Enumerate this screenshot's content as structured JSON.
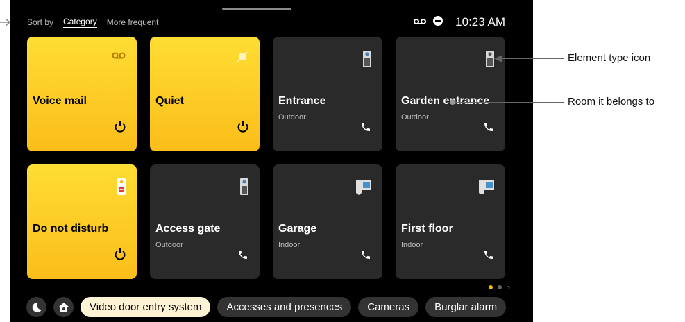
{
  "sort": {
    "label": "Sort by",
    "options": [
      "Category",
      "More frequent"
    ]
  },
  "status": {
    "time": "10:23 AM"
  },
  "tiles": [
    {
      "title": "Voice mail",
      "subtitle": ""
    },
    {
      "title": "Quiet",
      "subtitle": ""
    },
    {
      "title": "Entrance",
      "subtitle": "Outdoor"
    },
    {
      "title": "Garden entrance",
      "subtitle": "Outdoor"
    },
    {
      "title": "Do not disturb",
      "subtitle": ""
    },
    {
      "title": "Access gate",
      "subtitle": "Outdoor"
    },
    {
      "title": "Garage",
      "subtitle": "Indoor"
    },
    {
      "title": "First floor",
      "subtitle": "Indoor"
    }
  ],
  "pagination": {
    "pages": 3,
    "current": 1
  },
  "categories": [
    "Video door entry system",
    "Accesses and presences",
    "Cameras",
    "Burglar alarm"
  ],
  "annotations": {
    "type_icon": "Element type icon",
    "room": "Room it belongs to"
  },
  "colors": {
    "accent": "#fbbd1a",
    "tile_dark": "#2a2a2a",
    "pill_active": "#fff3d6"
  }
}
